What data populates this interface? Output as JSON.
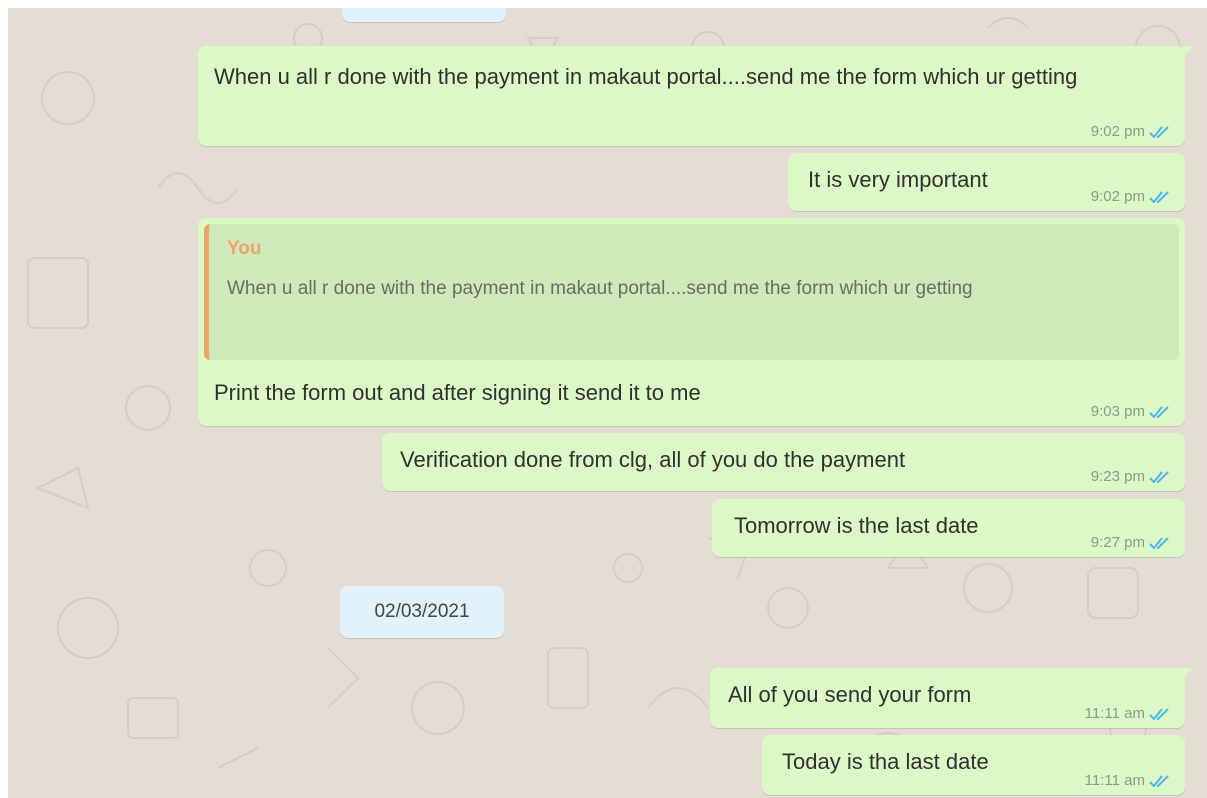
{
  "date_separator": "02/03/2021",
  "messages": [
    {
      "text": "When u all r done with the payment in makaut portal....send me the form which ur getting",
      "time": "9:02 pm",
      "status": "read"
    },
    {
      "text": "It is very important",
      "time": "9:02 pm",
      "status": "read"
    },
    {
      "quote_author": "You",
      "quote_text": "When u all r done with the payment in makaut portal....send me the form which ur getting",
      "text": "Print the form out and after signing it send it to me",
      "time": "9:03 pm",
      "status": "read"
    },
    {
      "text": "Verification done from clg, all of you do the payment",
      "time": "9:23 pm",
      "status": "read"
    },
    {
      "text": "Tomorrow is the last date",
      "time": "9:27 pm",
      "status": "read"
    },
    {
      "text": "All of you send your form",
      "time": "11:11 am",
      "status": "read"
    },
    {
      "text": "Today is tha last date",
      "time": "11:11 am",
      "status": "read"
    }
  ],
  "colors": {
    "chat_background": "#e4ddd4",
    "outgoing_bubble": "#dcf8c6",
    "date_pill": "#e1f2fb",
    "read_ticks": "#4fb6ec",
    "quote_accent": "#f0a46c",
    "meta_text": "#8a9a88"
  },
  "icons": {
    "read_receipt": "double-check-icon"
  }
}
